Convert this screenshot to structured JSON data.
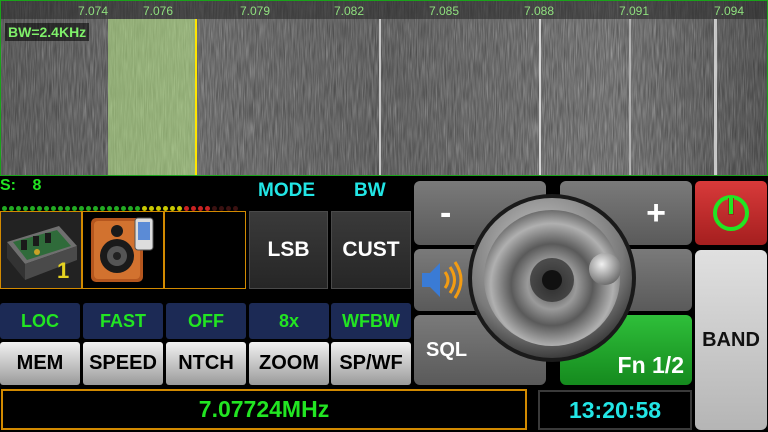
{
  "waterfall": {
    "bandwidth_label": "BW=2.4KHz",
    "freq_ticks": [
      "7.074",
      "7.076",
      "7.079",
      "7.082",
      "7.085",
      "7.088",
      "7.091",
      "7.094"
    ]
  },
  "s_meter": {
    "label": "S:",
    "value": "8"
  },
  "headers": {
    "mode": "MODE",
    "bw": "BW"
  },
  "mode_button": "LSB",
  "bw_button": "CUST",
  "images": {
    "radio_badge": "1"
  },
  "status_row": [
    "LOC",
    "FAST",
    "OFF",
    "8x",
    "WFBW"
  ],
  "function_row": [
    "MEM",
    "SPEED",
    "NTCH",
    "ZOOM",
    "SP/WF"
  ],
  "frequency_display": "7.07724MHz",
  "clock": "13:20:58",
  "controls": {
    "minus": "-",
    "plus": "+",
    "sql": "SQL",
    "fn": "Fn 1/2",
    "band": "BAND"
  },
  "colors": {
    "accent_green": "#22e522",
    "accent_cyan": "#22e5e5",
    "border_orange": "#d28a00",
    "power_red": "#c62828",
    "fn_green": "#22a52a"
  }
}
